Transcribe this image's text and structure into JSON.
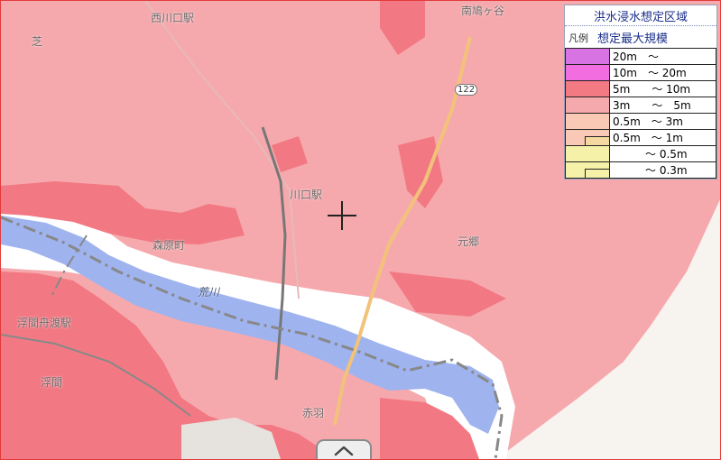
{
  "map": {
    "place_labels": [
      {
        "name": "nishikawaguchi-label",
        "text": "西川口駅"
      },
      {
        "name": "minamihatogaya-label",
        "text": "南鳩ヶ谷"
      },
      {
        "name": "shiba-label",
        "text": "芝"
      },
      {
        "name": "kawaguchi-station-label",
        "text": "川口駅"
      },
      {
        "name": "moriya-label",
        "text": "森原町"
      },
      {
        "name": "motogo-label",
        "text": "元郷"
      },
      {
        "name": "arakawa-label",
        "text": "荒川"
      },
      {
        "name": "shimura-label",
        "text": "赤羽"
      },
      {
        "name": "ukima-label",
        "text": "浮間舟渡駅"
      },
      {
        "name": "funado-label",
        "text": "浮間"
      }
    ],
    "route_badge": "122",
    "colors": {
      "flood_3m": "#f6a9ad",
      "flood_5m": "#f27983",
      "river": "#9fb3ef",
      "railway": "#777777",
      "road": "#f2c27b"
    }
  },
  "legend": {
    "title": "洪水浸水想定区域",
    "legend_mark": "凡例",
    "scale": "想定最大規模",
    "rows": [
      {
        "color": "#d873e3",
        "text": "20m　～"
      },
      {
        "color": "#f26ee0",
        "text": "10m　～ 20m"
      },
      {
        "color": "#f37a82",
        "text": "5m　　～ 10m"
      },
      {
        "color": "#f6a9ad",
        "text": "3m　　～　5m"
      },
      {
        "color": "#f9c9b5",
        "text": "0.5m　～ 3m"
      },
      {
        "color": "#f9c9b5",
        "sub": "#f5d9a0",
        "text": "0.5m　～ 1m"
      },
      {
        "color": "#f5f1a8",
        "text": "　　　～ 0.5m"
      },
      {
        "color": "#f5f1a8",
        "sub": "#f5f1a8",
        "text": "　　　～ 0.3m"
      }
    ]
  },
  "controls": {
    "collapse_icon": "chevron-up-icon"
  }
}
